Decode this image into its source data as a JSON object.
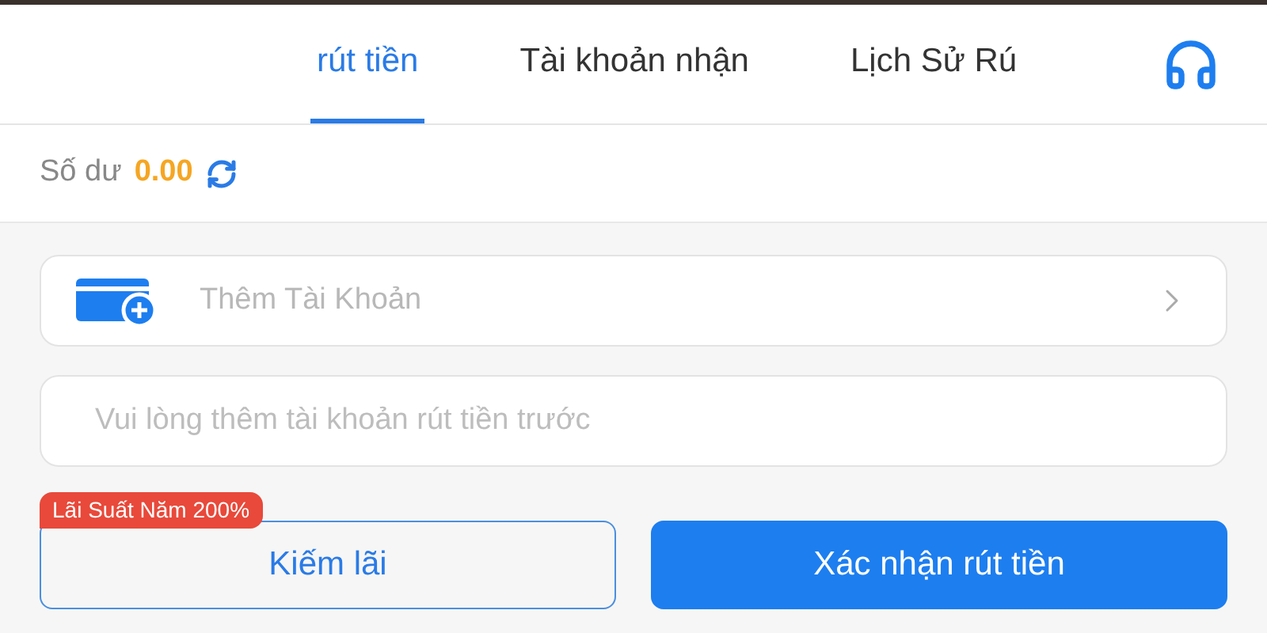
{
  "tabs": [
    {
      "label": "rút tiền",
      "selected": true
    },
    {
      "label": "Tài khoản nhận",
      "selected": false
    },
    {
      "label": "Lịch Sử Rú",
      "selected": false
    }
  ],
  "balance": {
    "label": "Số dư",
    "amount": "0.00"
  },
  "account_row": {
    "label": "Thêm Tài Khoản"
  },
  "amount_field": {
    "placeholder": "Vui lòng thêm tài khoản rút tiền trước"
  },
  "interest_badge": "Lãi Suất Năm 200%",
  "buttons": [
    {
      "label": "Kiếm lãi",
      "kind": "outline"
    },
    {
      "label": "Xác nhận rút tiền",
      "kind": "primary"
    }
  ]
}
